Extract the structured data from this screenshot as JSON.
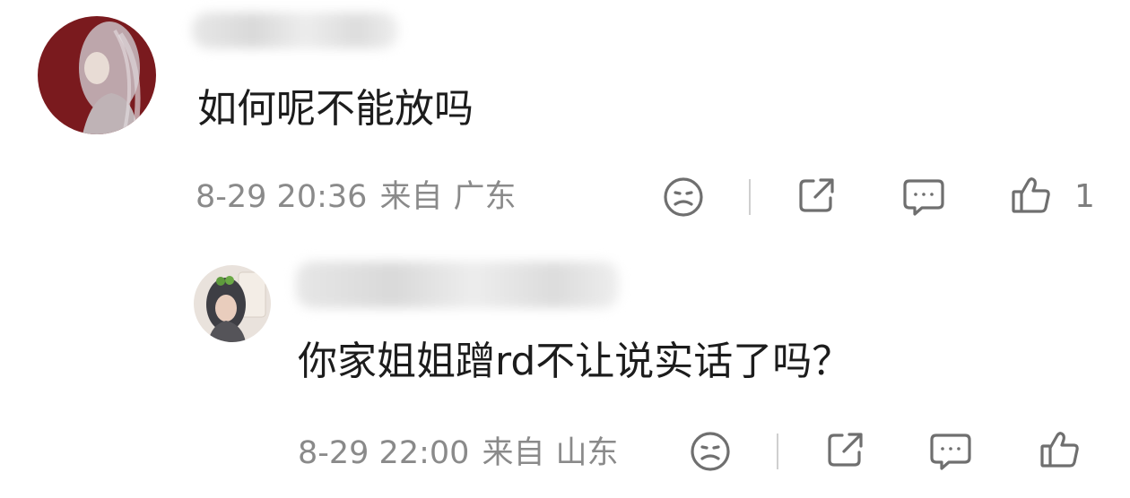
{
  "comments": [
    {
      "body": "如何呢不能放吗",
      "time": "8-29 20:36",
      "location_prefix": "来自",
      "location": "广东",
      "like_count": "1"
    },
    {
      "body": "你家姐姐蹭rd不让说实话了吗？",
      "time": "8-29 22:00",
      "location_prefix": "来自",
      "location": "山东"
    }
  ],
  "icons": {
    "dislike": "sad-face-icon",
    "share": "share-icon",
    "reply": "comment-icon",
    "like": "thumbs-up-icon"
  },
  "colors": {
    "meta_text": "#8a8a8a",
    "icon_stroke": "#6f6f6f",
    "body_text": "#1c1c1c",
    "avatar_1_bg": "#7a1a1e"
  }
}
